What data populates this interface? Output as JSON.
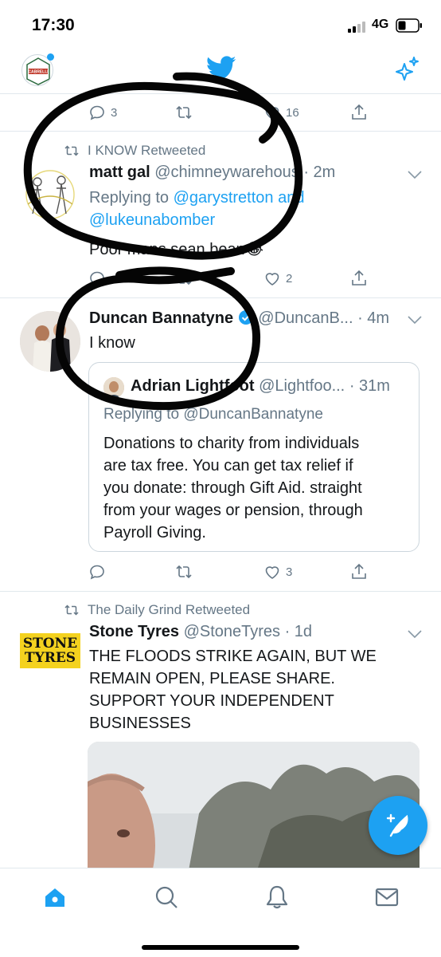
{
  "status_bar": {
    "time": "17:30",
    "network": "4G"
  },
  "colors": {
    "accent": "#1da1f2",
    "text": "#14171a",
    "muted": "#657786",
    "divider": "#e1e8ed"
  },
  "header": {
    "profile_badge_text": "CABRELLI"
  },
  "prev_tweet": {
    "reply_count": "3",
    "like_count": "16"
  },
  "tweet1": {
    "retweeted_by": "I KNOW Retweeted",
    "name": "matt gal",
    "handle": "@chimneywarehous",
    "time": "· 2m",
    "replying_prefix": "Replying to",
    "reply_user1": "@garystretton",
    "reply_and": "and",
    "reply_user2": "@lukeunabomber",
    "text": "Poor mans sean bean😂",
    "like_count": "2"
  },
  "tweet2": {
    "name": "Duncan Bannatyne",
    "handle": "@DuncanB...",
    "time": "· 4m",
    "text": "I know",
    "like_count": "3",
    "quote": {
      "name": "Adrian Lightfoot",
      "handle": "@Lightfoo...",
      "time": "· 31m",
      "replying": "Replying to @DuncanBannatyne",
      "text_lines": [
        "Donations to charity from individuals",
        "are tax free. You can get tax relief if",
        "you donate: through Gift Aid. straight",
        "from your wages or pension, through",
        "Payroll Giving."
      ]
    }
  },
  "tweet3": {
    "retweeted_by": "The Daily Grind Retweeted",
    "name": "Stone Tyres",
    "handle": "@StoneTyres",
    "time": "· 1d",
    "avatar_text_top": "STONE",
    "avatar_text_bottom": "TYRES",
    "text_lines": [
      "THE FLOODS STRIKE AGAIN, BUT WE",
      "REMAIN OPEN, PLEASE SHARE.",
      "SUPPORT YOUR INDEPENDENT",
      "BUSINESSES"
    ]
  },
  "tabs": [
    {
      "name": "home-icon"
    },
    {
      "name": "search-icon"
    },
    {
      "name": "bell-icon"
    },
    {
      "name": "mail-icon"
    }
  ]
}
